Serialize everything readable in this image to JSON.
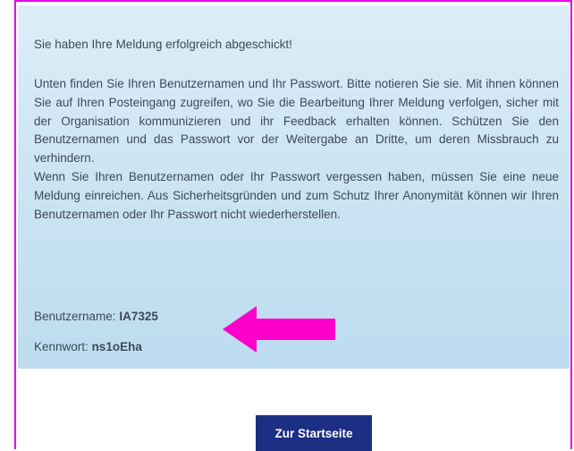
{
  "message": {
    "headline": "Sie haben Ihre Meldung erfolgreich abgeschickt!",
    "paragraph1": "Unten finden Sie Ihren Benutzernamen und Ihr Passwort. Bitte notieren Sie sie. Mit ihnen können Sie auf Ihren Posteingang zugreifen, wo Sie die Bearbeitung Ihrer Meldung verfolgen, sicher mit der Organisation kommunizieren und ihr Feedback erhalten können. Schützen Sie den Benutzernamen und das Passwort vor der Weitergabe an Dritte, um deren Missbrauch zu verhindern.",
    "paragraph2": "Wenn Sie Ihren Benutzernamen oder Ihr Passwort vergessen haben, müssen Sie eine neue Meldung einreichen. Aus Sicherheitsgründen und zum Schutz Ihrer Anonymität können wir Ihren Benutzernamen oder Ihr Passwort nicht wiederherstellen."
  },
  "credentials": {
    "username_label": "Benutzername:",
    "username_value": "IA7325",
    "password_label": "Kennwort:",
    "password_value": "ns1oEha"
  },
  "actions": {
    "home_button_label": "Zur Startseite"
  },
  "colors": {
    "frame_border": "#e600e6",
    "arrow": "#ff00cc",
    "info_box_top": "#dceef8",
    "info_box_bottom": "#bcdcef",
    "button_bg": "#1d2f82",
    "text": "#3b4a57"
  },
  "icons": {
    "annotation": "left-arrow-icon"
  }
}
